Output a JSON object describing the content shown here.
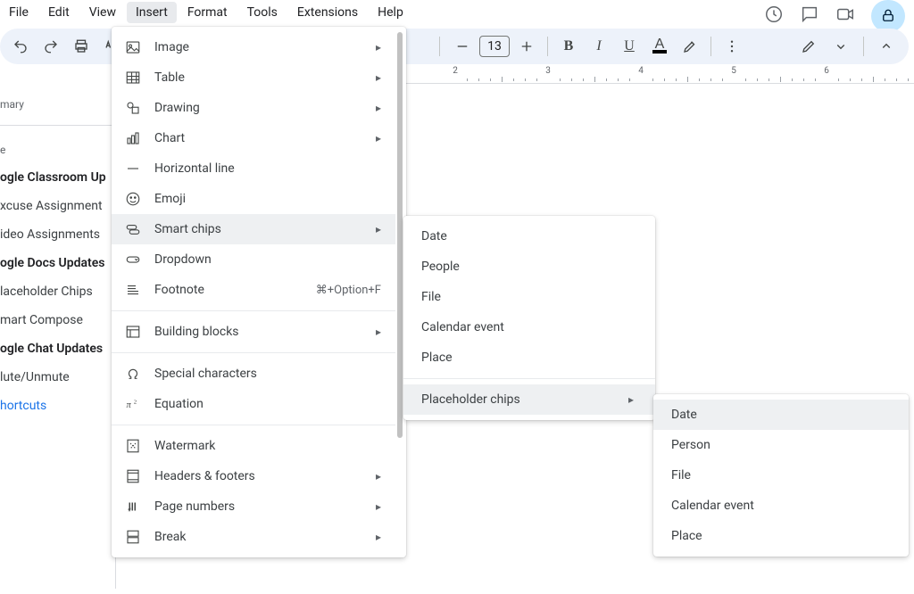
{
  "menubar": [
    "File",
    "Edit",
    "View",
    "Insert",
    "Format",
    "Tools",
    "Extensions",
    "Help"
  ],
  "menubar_active_index": 3,
  "toolbar": {
    "font_size": "13"
  },
  "sidebar": {
    "heading1": "mary",
    "heading2": "e",
    "items": [
      {
        "text": "ogle Classroom Up",
        "bold": true
      },
      {
        "text": "xcuse Assignment"
      },
      {
        "text": "ideo Assignments"
      },
      {
        "text": "ogle Docs Updates",
        "bold": true
      },
      {
        "text": "laceholder Chips"
      },
      {
        "text": "mart Compose"
      },
      {
        "text": "ogle Chat Updates",
        "bold": true
      },
      {
        "text": "lute/Unmute"
      },
      {
        "text": "hortcuts",
        "link": true
      }
    ]
  },
  "ruler_numbers": [
    2,
    3,
    4,
    5,
    6
  ],
  "insert_menu": {
    "shortcut_footnote": "⌘+Option+F",
    "groups": [
      [
        {
          "label": "Image",
          "icon": "image-icon",
          "submenu": true
        },
        {
          "label": "Table",
          "icon": "table-icon",
          "submenu": true
        },
        {
          "label": "Drawing",
          "icon": "drawing-icon",
          "submenu": true
        },
        {
          "label": "Chart",
          "icon": "chart-icon",
          "submenu": true
        },
        {
          "label": "Horizontal line",
          "icon": "hline-icon"
        },
        {
          "label": "Emoji",
          "icon": "emoji-icon"
        },
        {
          "label": "Smart chips",
          "icon": "chips-icon",
          "submenu": true,
          "highlight": true
        },
        {
          "label": "Dropdown",
          "icon": "dropdown-icon"
        },
        {
          "label": "Footnote",
          "icon": "footnote-icon",
          "shortcut": true
        }
      ],
      [
        {
          "label": "Building blocks",
          "icon": "blocks-icon",
          "submenu": true
        }
      ],
      [
        {
          "label": "Special characters",
          "icon": "omega-icon"
        },
        {
          "label": "Equation",
          "icon": "equation-icon"
        }
      ],
      [
        {
          "label": "Watermark",
          "icon": "watermark-icon"
        },
        {
          "label": "Headers & footers",
          "icon": "headerfooter-icon",
          "submenu": true
        },
        {
          "label": "Page numbers",
          "icon": "pagenum-icon",
          "submenu": true
        },
        {
          "label": "Break",
          "icon": "break-icon",
          "submenu": true
        }
      ]
    ]
  },
  "smart_chips_menu": {
    "items": [
      "Date",
      "People",
      "File",
      "Calendar event",
      "Place"
    ],
    "placeholder_label": "Placeholder chips",
    "placeholder_highlight": true
  },
  "placeholder_chips_menu": {
    "items": [
      "Date",
      "Person",
      "File",
      "Calendar event",
      "Place"
    ],
    "highlight_index": 0
  }
}
